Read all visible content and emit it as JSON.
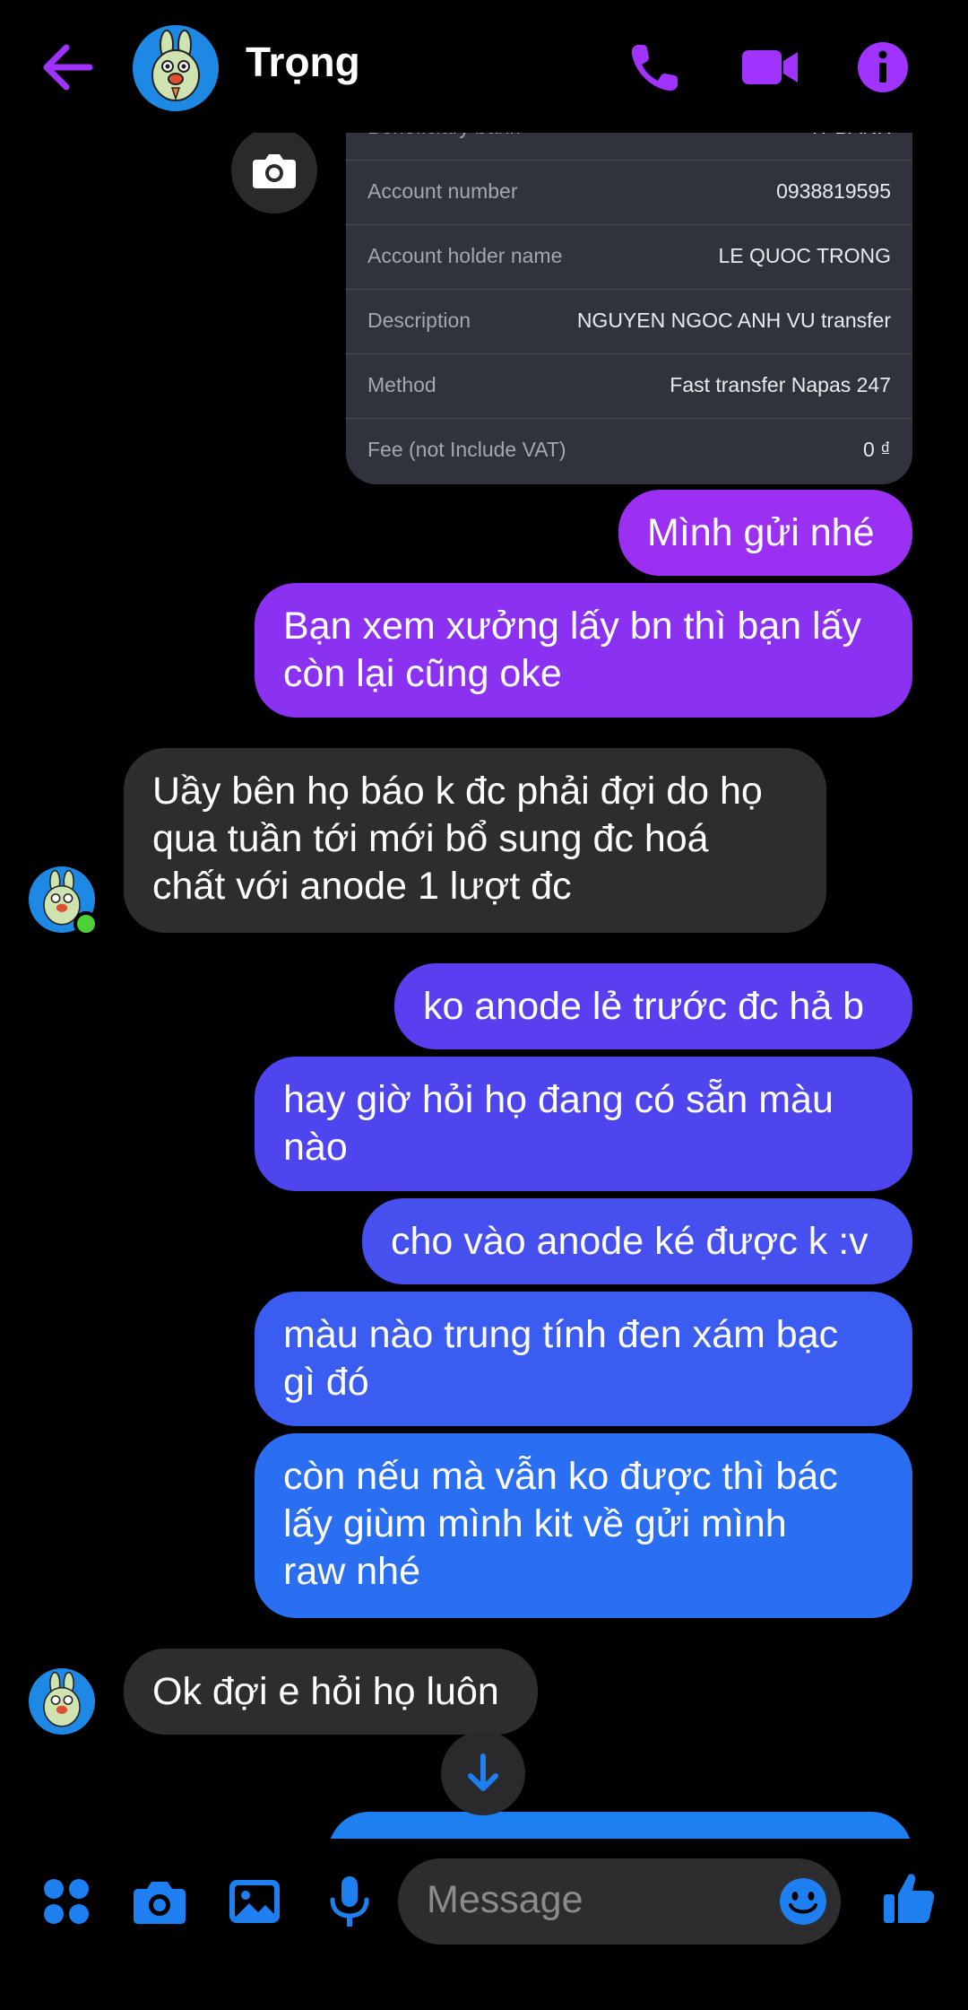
{
  "header": {
    "contact_name": "Trọng",
    "accent_color": "#a033ff"
  },
  "transfer_card": {
    "partial_label": "Beneficiary bank",
    "partial_value": "TPBANK",
    "rows": [
      {
        "label": "Account number",
        "value": "0938819595"
      },
      {
        "label": "Account holder name",
        "value": "LE QUOC TRONG"
      },
      {
        "label": "Description",
        "value": "NGUYEN NGOC ANH VU transfer"
      },
      {
        "label": "Method",
        "value": "Fast transfer Napas 247"
      },
      {
        "label": "Fee (not Include VAT)",
        "value": "0 ₫"
      }
    ]
  },
  "messages": [
    {
      "from": "me",
      "text": "Mình gửi nhé",
      "color": "#9b2ff2"
    },
    {
      "from": "me",
      "text": "Bạn xem xưởng lấy bn thì bạn lấy\ncòn lại cũng oke",
      "color": "#8b32f2"
    },
    {
      "from": "them",
      "text": "Uầy bên họ báo k đc phải đợi do họ\nqua tuần tới mới bổ sung đc hoá\nchất với anode 1 lượt đc"
    },
    {
      "from": "me",
      "text": "ko anode lẻ trước đc hả b",
      "color": "#5a3ff0"
    },
    {
      "from": "me",
      "text": "hay giờ hỏi họ đang có sẵn màu\nnào",
      "color": "#4f45ee"
    },
    {
      "from": "me",
      "text": "cho vào anode ké được k :v",
      "color": "#4650ee"
    },
    {
      "from": "me",
      "text": "màu nào trung tính đen xám bạc\ngì đó",
      "color": "#3a5cf0"
    },
    {
      "from": "me",
      "text": "còn nếu mà vẫn ko được thì bác\nlấy giùm mình kit về gửi mình\nraw nhé",
      "color": "#2a6ef2"
    },
    {
      "from": "them",
      "text": "Ok đợi e hỏi họ luôn"
    }
  ],
  "composer": {
    "placeholder": "Message",
    "accent_color": "#1e7ff0"
  }
}
